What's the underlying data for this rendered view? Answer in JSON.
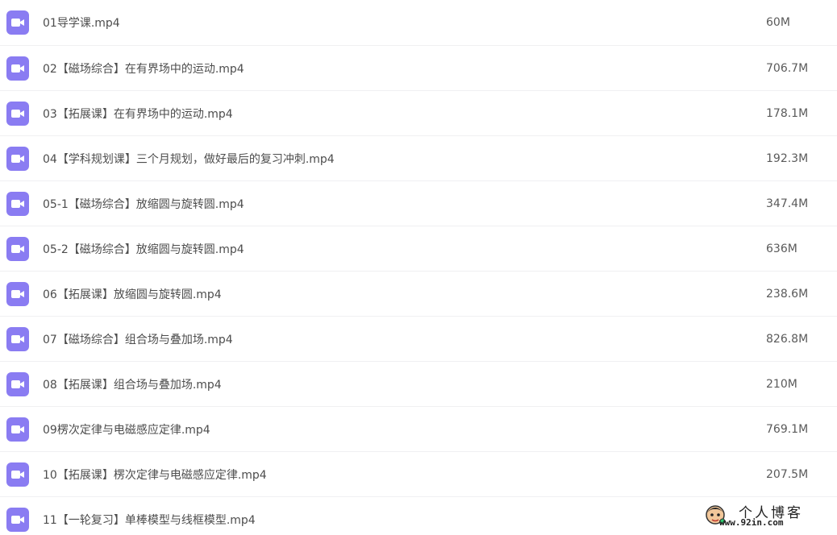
{
  "files": [
    {
      "name": "01导学课.mp4",
      "size": "60M"
    },
    {
      "name": "02【磁场综合】在有界场中的运动.mp4",
      "size": "706.7M"
    },
    {
      "name": "03【拓展课】在有界场中的运动.mp4",
      "size": "178.1M"
    },
    {
      "name": "04【学科规划课】三个月规划，做好最后的复习冲刺.mp4",
      "size": "192.3M"
    },
    {
      "name": "05-1【磁场综合】放缩圆与旋转圆.mp4",
      "size": "347.4M"
    },
    {
      "name": "05-2【磁场综合】放缩圆与旋转圆.mp4",
      "size": "636M"
    },
    {
      "name": "06【拓展课】放缩圆与旋转圆.mp4",
      "size": "238.6M"
    },
    {
      "name": "07【磁场综合】组合场与叠加场.mp4",
      "size": "826.8M"
    },
    {
      "name": "08【拓展课】组合场与叠加场.mp4",
      "size": "210M"
    },
    {
      "name": "09楞次定律与电磁感应定律.mp4",
      "size": "769.1M"
    },
    {
      "name": "10【拓展课】楞次定律与电磁感应定律.mp4",
      "size": "207.5M"
    },
    {
      "name": "11【一轮复习】单棒模型与线框模型.mp4",
      "size": ""
    }
  ],
  "watermark": {
    "title": "个人博客",
    "url": "www.92in.com"
  },
  "colors": {
    "icon_bg": "#8a7cf2",
    "text": "#4d4d4d",
    "divider": "#f0f0f2"
  },
  "icons": {
    "file": "video-camera-icon",
    "watermark_logo": "mascot-logo"
  }
}
